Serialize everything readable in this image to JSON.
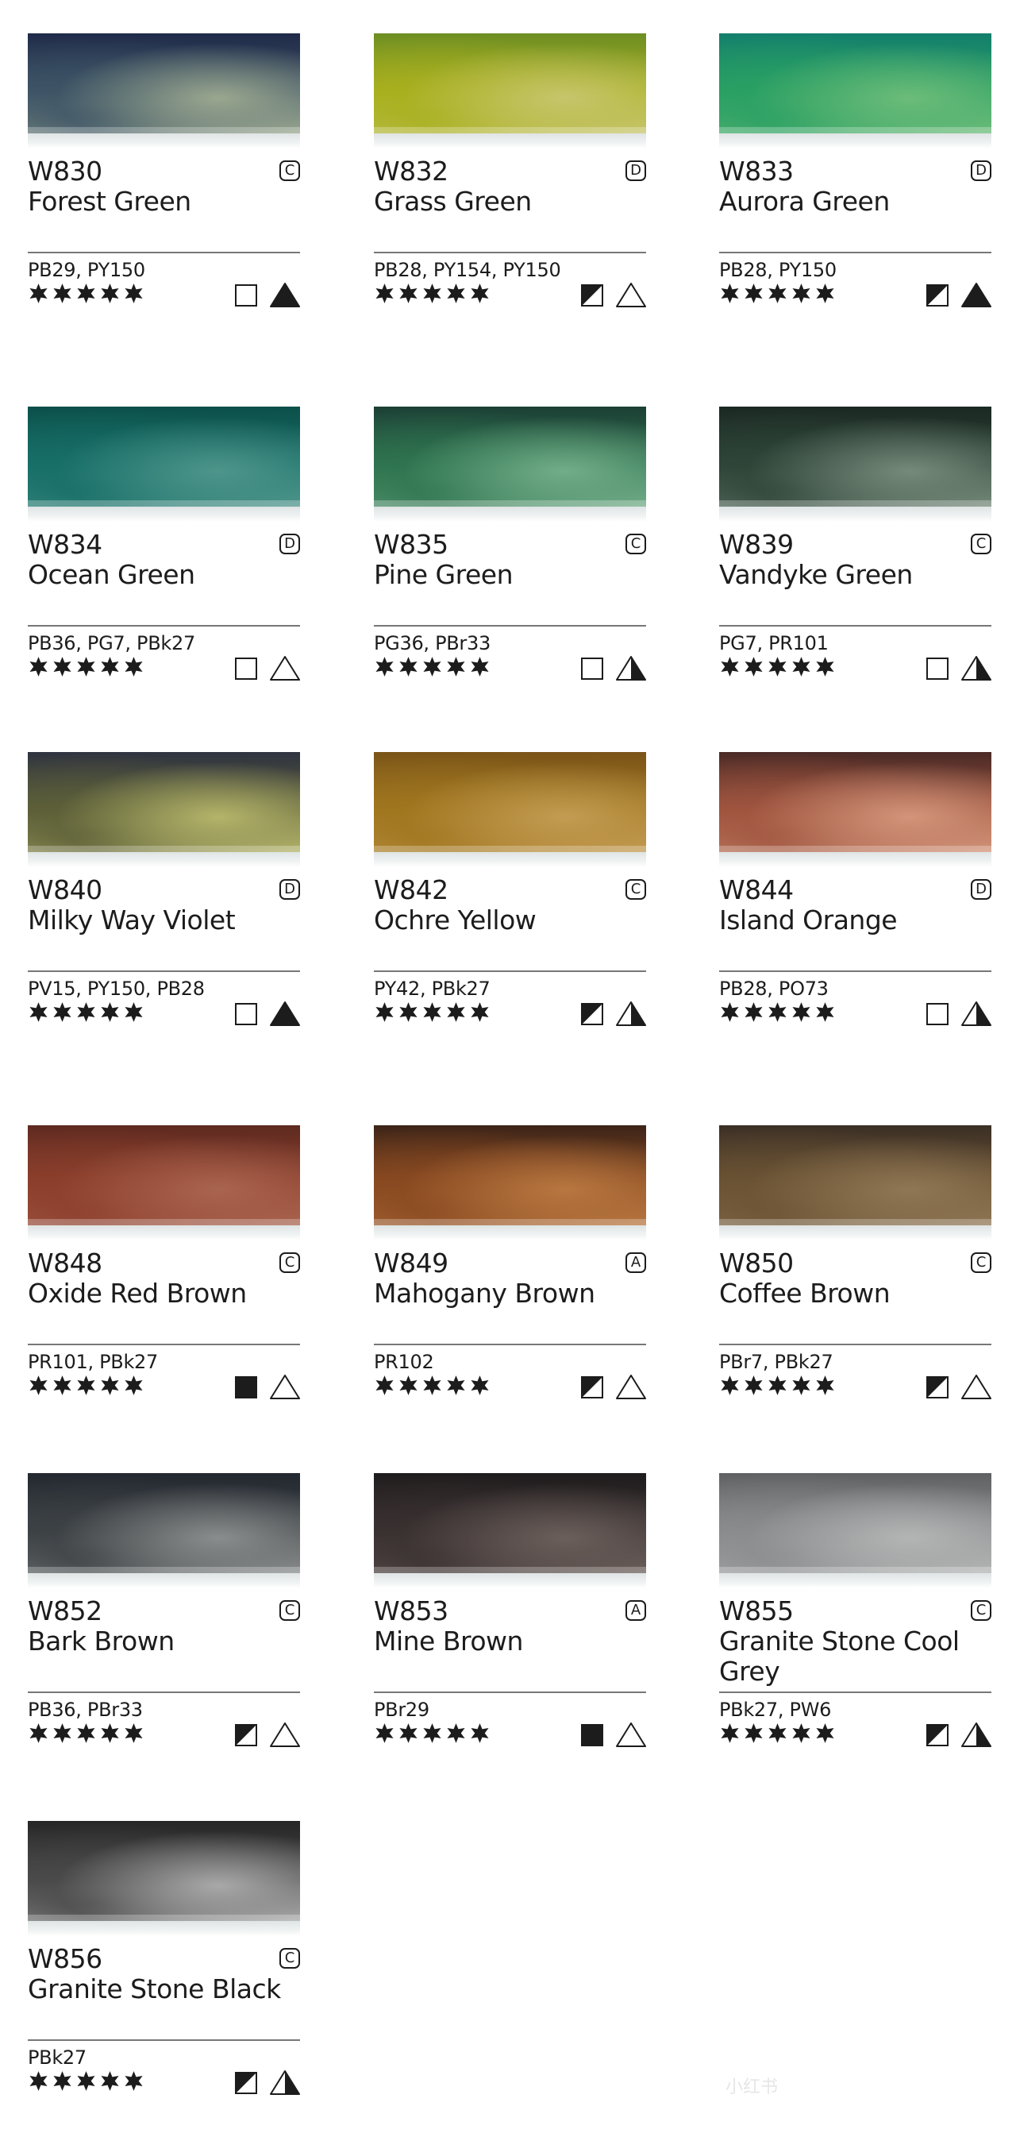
{
  "colors": [
    {
      "code": "W830",
      "name": "Forest Green",
      "grade": "C",
      "pigments": "PB29, PY150",
      "stars": 5,
      "opacity": "transparent",
      "staining": "full",
      "swatch": {
        "top": "#1f2a49",
        "mid": "#3e5566",
        "bot": "#9aa78f"
      }
    },
    {
      "code": "W832",
      "name": "Grass Green",
      "grade": "D",
      "pigments": "PB28, PY154, PY150",
      "stars": 5,
      "opacity": "semi-transparent",
      "staining": "none",
      "swatch": {
        "top": "#6d8e23",
        "mid": "#a9b01e",
        "bot": "#c7c56c"
      }
    },
    {
      "code": "W833",
      "name": "Aurora Green",
      "grade": "D",
      "pigments": "PB28, PY150",
      "stars": 5,
      "opacity": "semi-transparent",
      "staining": "full",
      "swatch": {
        "top": "#137f6c",
        "mid": "#2aa063",
        "bot": "#6cbc79"
      }
    },
    {
      "code": "W834",
      "name": "Ocean Green",
      "grade": "D",
      "pigments": "PB36, PG7, PBk27",
      "stars": 5,
      "opacity": "transparent",
      "staining": "none",
      "swatch": {
        "top": "#0c4f4a",
        "mid": "#176f68",
        "bot": "#4e958b"
      }
    },
    {
      "code": "W835",
      "name": "Pine Green",
      "grade": "C",
      "pigments": "PG36, PBr33",
      "stars": 5,
      "opacity": "transparent",
      "staining": "half",
      "swatch": {
        "top": "#1c3f35",
        "mid": "#2f7450",
        "bot": "#72ad88"
      }
    },
    {
      "code": "W839",
      "name": "Vandyke Green",
      "grade": "C",
      "pigments": "PG7, PR101",
      "stars": 5,
      "opacity": "transparent",
      "staining": "half",
      "swatch": {
        "top": "#1b2923",
        "mid": "#2e4538",
        "bot": "#768a7b"
      }
    },
    {
      "code": "W840",
      "name": "Milky Way Violet",
      "grade": "D",
      "pigments": "PV15, PY150, PB28",
      "stars": 5,
      "opacity": "transparent",
      "staining": "full",
      "swatch": {
        "top": "#2f3340",
        "mid": "#5d6038",
        "bot": "#b4b46a"
      }
    },
    {
      "code": "W842",
      "name": "Ochre Yellow",
      "grade": "C",
      "pigments": "PY42, PBk27",
      "stars": 5,
      "opacity": "semi-transparent",
      "staining": "half",
      "swatch": {
        "top": "#7a5418",
        "mid": "#a0761f",
        "bot": "#c39b52"
      }
    },
    {
      "code": "W844",
      "name": "Island Orange",
      "grade": "D",
      "pigments": "PB28, PO73",
      "stars": 5,
      "opacity": "transparent",
      "staining": "half",
      "swatch": {
        "top": "#4a2a26",
        "mid": "#a0553f",
        "bot": "#d2947a"
      }
    },
    {
      "code": "W848",
      "name": "Oxide Red Brown",
      "grade": "C",
      "pigments": "PR101, PBk27",
      "stars": 5,
      "opacity": "opaque",
      "staining": "none",
      "swatch": {
        "top": "#5e2a20",
        "mid": "#8c3f2c",
        "bot": "#a9644f"
      }
    },
    {
      "code": "W849",
      "name": "Mahogany Brown",
      "grade": "A",
      "pigments": "PR102",
      "stars": 5,
      "opacity": "semi-transparent",
      "staining": "none",
      "swatch": {
        "top": "#3c2418",
        "mid": "#8a4a21",
        "bot": "#b87740"
      }
    },
    {
      "code": "W850",
      "name": "Coffee Brown",
      "grade": "C",
      "pigments": "PBr7, PBk27",
      "stars": 5,
      "opacity": "semi-transparent",
      "staining": "none",
      "swatch": {
        "top": "#3b2f25",
        "mid": "#6b5334",
        "bot": "#8f7654"
      }
    },
    {
      "code": "W852",
      "name": "Bark Brown",
      "grade": "C",
      "pigments": "PB36, PBr33",
      "stars": 5,
      "opacity": "semi-transparent",
      "staining": "none",
      "swatch": {
        "top": "#232830",
        "mid": "#3d4245",
        "bot": "#8a8d8d"
      }
    },
    {
      "code": "W853",
      "name": "Mine Brown",
      "grade": "A",
      "pigments": "PBr29",
      "stars": 5,
      "opacity": "opaque",
      "staining": "none",
      "swatch": {
        "top": "#1f1c1d",
        "mid": "#3a3131",
        "bot": "#6b5f5b"
      }
    },
    {
      "code": "W855",
      "name": "Granite Stone Cool Grey",
      "grade": "C",
      "pigments": "PBk27, PW6",
      "stars": 5,
      "opacity": "semi-transparent",
      "staining": "half",
      "swatch": {
        "top": "#5f6163",
        "mid": "#8a8c8d",
        "bot": "#b3b5b5"
      }
    },
    {
      "code": "W856",
      "name": "Granite Stone Black",
      "grade": "C",
      "pigments": "PBk27",
      "stars": 5,
      "opacity": "semi-transparent",
      "staining": "half",
      "swatch": {
        "top": "#262626",
        "mid": "#4a4a4a",
        "bot": "#a9a9a9"
      }
    }
  ],
  "watermark": "小红书"
}
